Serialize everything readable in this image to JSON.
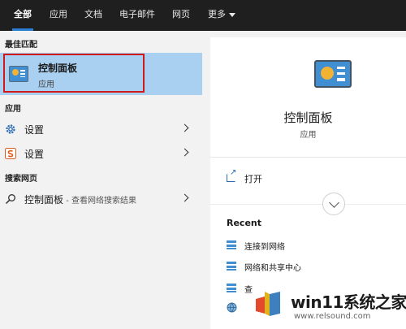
{
  "tabs": [
    {
      "label": "全部",
      "active": true
    },
    {
      "label": "应用"
    },
    {
      "label": "文档"
    },
    {
      "label": "电子邮件"
    },
    {
      "label": "网页"
    },
    {
      "label": "更多"
    }
  ],
  "sections": {
    "best_match": "最佳匹配",
    "apps": "应用",
    "web": "搜索网页"
  },
  "best_match": {
    "title": "控制面板",
    "subtitle": "应用",
    "icon": "control-panel-icon"
  },
  "app_results": [
    {
      "label": "设置",
      "icon": "gear-icon"
    },
    {
      "label": "设置",
      "icon": "settings-app-icon"
    }
  ],
  "web_result": {
    "label": "控制面板",
    "suffix": " - 查看网络搜索结果",
    "icon": "search-icon"
  },
  "preview": {
    "title": "控制面板",
    "subtitle": "应用",
    "open_label": "打开",
    "recent_header": "Recent",
    "recent_items": [
      {
        "label": "连接到网络"
      },
      {
        "label": "网络和共享中心"
      },
      {
        "label": "查"
      }
    ]
  },
  "watermark": {
    "text": "win11系统之家",
    "url": "www.relsound.com"
  },
  "colors": {
    "topbar": "#1f1f1f",
    "selection": "#a9d0f0",
    "highlight_border": "#d01919",
    "accent": "#2b7fd4"
  }
}
